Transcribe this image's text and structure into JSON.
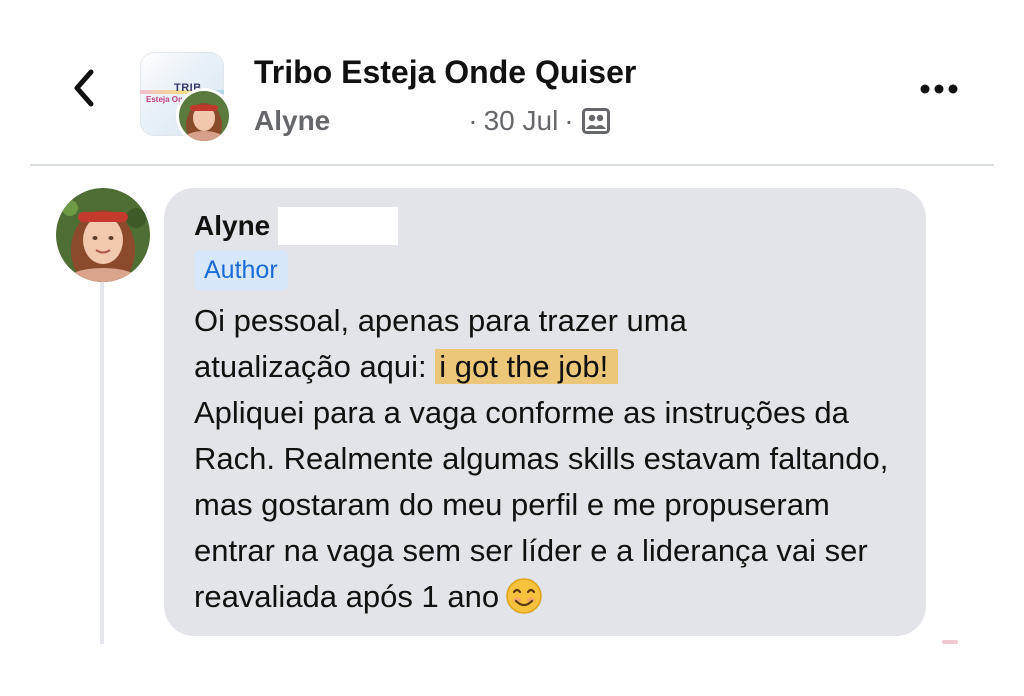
{
  "header": {
    "back_icon": "chevron-left-icon",
    "group_name": "Tribo Esteja Onde Quiser",
    "logo_text_line1": "TRIB",
    "logo_text_line2": "Esteja Onde",
    "author_name": "Alyne",
    "separator": "·",
    "date": "30 Jul",
    "privacy_icon": "group-privacy-icon",
    "more_icon": "more-horizontal-icon"
  },
  "comment": {
    "author_name": "Alyne",
    "badge": "Author",
    "line1": "Oi pessoal, apenas para trazer uma",
    "line2_prefix": "atualização aqui: ",
    "highlight": "i got the job!",
    "body": "Apliquei para a vaga conforme as instruções da Rach. Realmente algumas skills estavam faltando, mas gostaram do meu perfil e me propuseram entrar na vaga sem ser líder e a liderança vai ser reavaliada após 1 ano",
    "emoji": "smiling-face-emoji"
  },
  "colors": {
    "bubble": "#e2e4e9",
    "badge_bg": "#d8e8fa",
    "badge_text": "#1a6bd6",
    "highlight": "#ecc77a",
    "meta_text": "#65676b"
  }
}
